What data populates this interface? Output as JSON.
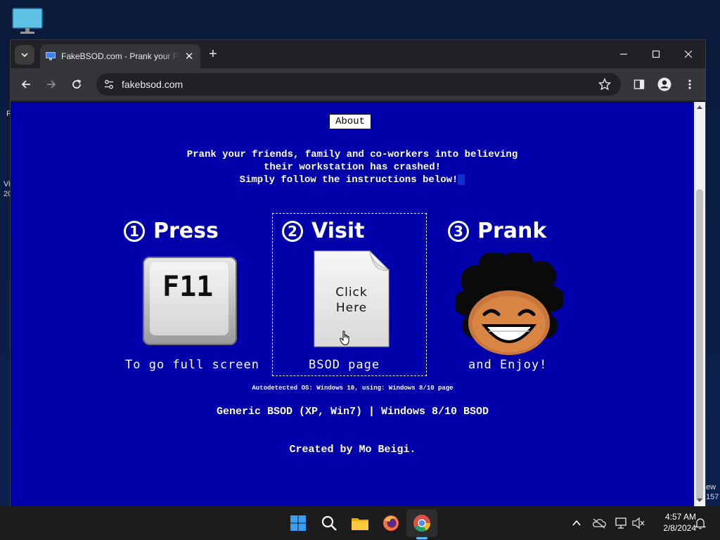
{
  "desktop": {
    "fragments": [
      "R",
      "Vi",
      "20",
      "ew",
      "157"
    ]
  },
  "browser": {
    "tab": {
      "title": "FakeBSOD.com - Prank your Friends"
    },
    "address": {
      "url": "fakebsod.com"
    }
  },
  "page": {
    "about_label": "About",
    "intro": [
      "Prank your friends, family and co-workers into believing",
      "their workstation has crashed!",
      "Simply follow the instructions below!"
    ],
    "steps": [
      {
        "number": "1",
        "title": "Press",
        "key_label": "F11",
        "caption": "To go full screen"
      },
      {
        "number": "2",
        "title": "Visit",
        "doc_label_1": "Click",
        "doc_label_2": "Here",
        "caption": "BSOD page"
      },
      {
        "number": "3",
        "title": "Prank",
        "caption": "and Enjoy!"
      }
    ],
    "autodetect": "Autodetected OS: Windows 10, using: Windows 8/10 page",
    "links": {
      "generic": "Generic BSOD (XP, Win7)",
      "separator": " | ",
      "win810": "Windows 8/10 BSOD"
    },
    "credit": "Created by Mo Beigi."
  },
  "taskbar": {
    "apps": [
      "start-icon",
      "search-icon",
      "file-explorer-icon",
      "firefox-icon",
      "chrome-icon"
    ],
    "time": "4:57 AM",
    "date": "2/8/2024"
  },
  "colors": {
    "page_bg": "#0000aa",
    "browser_chrome": "#35363a",
    "taskbar_bg": "#1c1c1c"
  }
}
